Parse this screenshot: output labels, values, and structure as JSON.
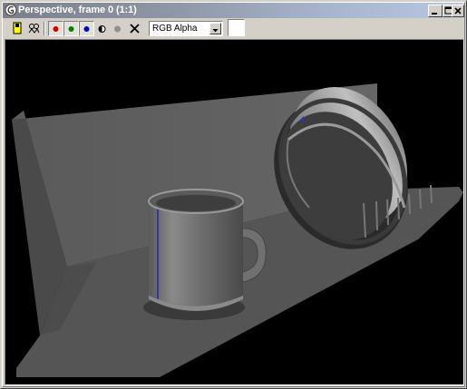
{
  "window": {
    "title": "Perspective, frame 0 (1:1)",
    "controls": {
      "minimize": "_",
      "maximize": "□",
      "close": "X"
    }
  },
  "toolbar": {
    "channel_select": "RGB Alpha",
    "tools": [
      {
        "name": "save-image-icon"
      },
      {
        "name": "clone-window-icon"
      },
      {
        "name": "red-channel-icon",
        "color": "#d40000"
      },
      {
        "name": "green-channel-icon",
        "color": "#008000"
      },
      {
        "name": "blue-channel-icon",
        "color": "#0000cc"
      },
      {
        "name": "alpha-channel-icon"
      },
      {
        "name": "mono-channel-icon"
      },
      {
        "name": "clear-icon"
      }
    ],
    "swatch_color": "#ffffff"
  },
  "viewport": {
    "scene": "3d-render",
    "background": "#000000",
    "objects": [
      "floor",
      "back-wall",
      "side-wall",
      "mug",
      "plate",
      "plate-rack"
    ]
  }
}
